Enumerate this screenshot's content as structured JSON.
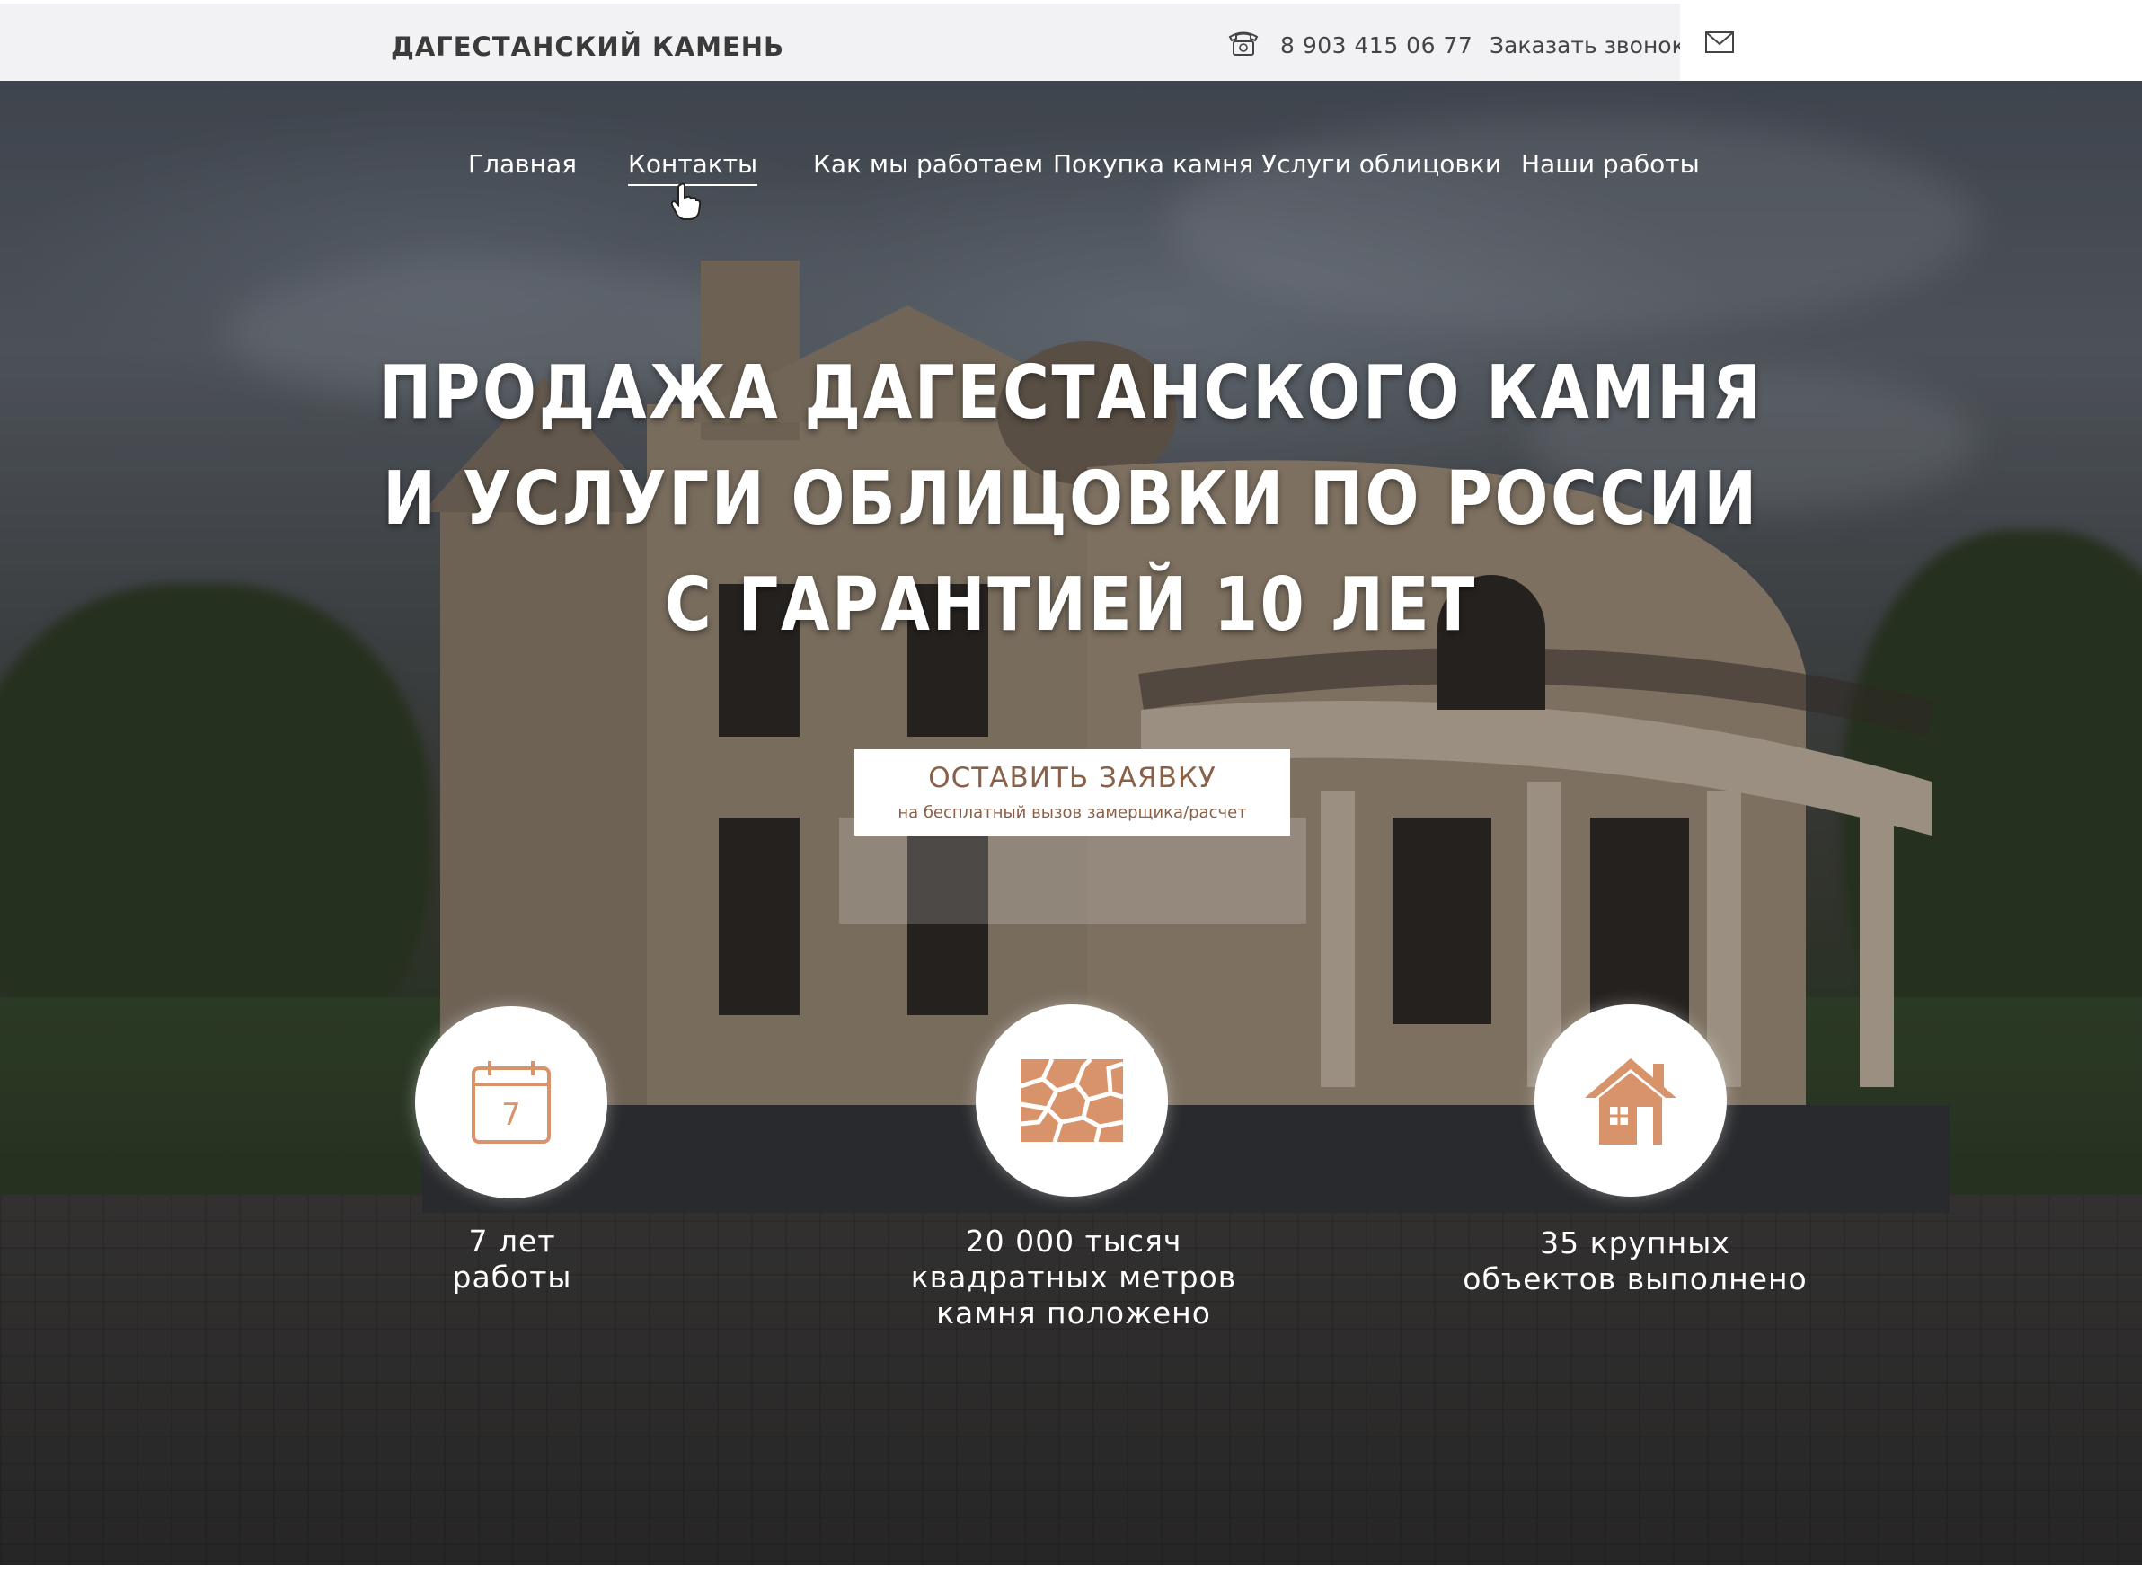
{
  "header": {
    "logo": "ДАГЕСТАНСКИЙ КАМЕНЬ",
    "phone": "8 903 415 06 77",
    "callback": "Заказать звонок"
  },
  "nav": {
    "items": [
      {
        "label": "Главная"
      },
      {
        "label": "Контакты"
      },
      {
        "label": "Как мы работаем"
      },
      {
        "label": "Покупка камня"
      },
      {
        "label": "Услуги облицовки"
      },
      {
        "label": "Наши работы"
      }
    ]
  },
  "hero": {
    "headline_lines": [
      "ПРОДАЖА ДАГЕСТАНСКОГО КАМНЯ",
      "И УСЛУГИ ОБЛИЦОВКИ ПО РОССИИ",
      "С ГАРАНТИЕЙ 10 ЛЕТ"
    ],
    "cta_title": "ОСТАВИТЬ ЗАЯВКУ",
    "cta_subtitle": "на бесплатный вызов замерщика/расчет"
  },
  "stats": [
    {
      "icon": "calendar-icon",
      "icon_text": "7",
      "lines": [
        "7 лет",
        "работы"
      ]
    },
    {
      "icon": "stone-icon",
      "lines": [
        "20 000 тысяч",
        "квадратных метров",
        "камня положено"
      ]
    },
    {
      "icon": "house-icon",
      "lines": [
        "35 крупных",
        "объектов выполнено"
      ]
    }
  ],
  "colors": {
    "accent": "#d9936a",
    "cta_text": "#8a6048",
    "topbar_bg": "#f2f1f3"
  }
}
